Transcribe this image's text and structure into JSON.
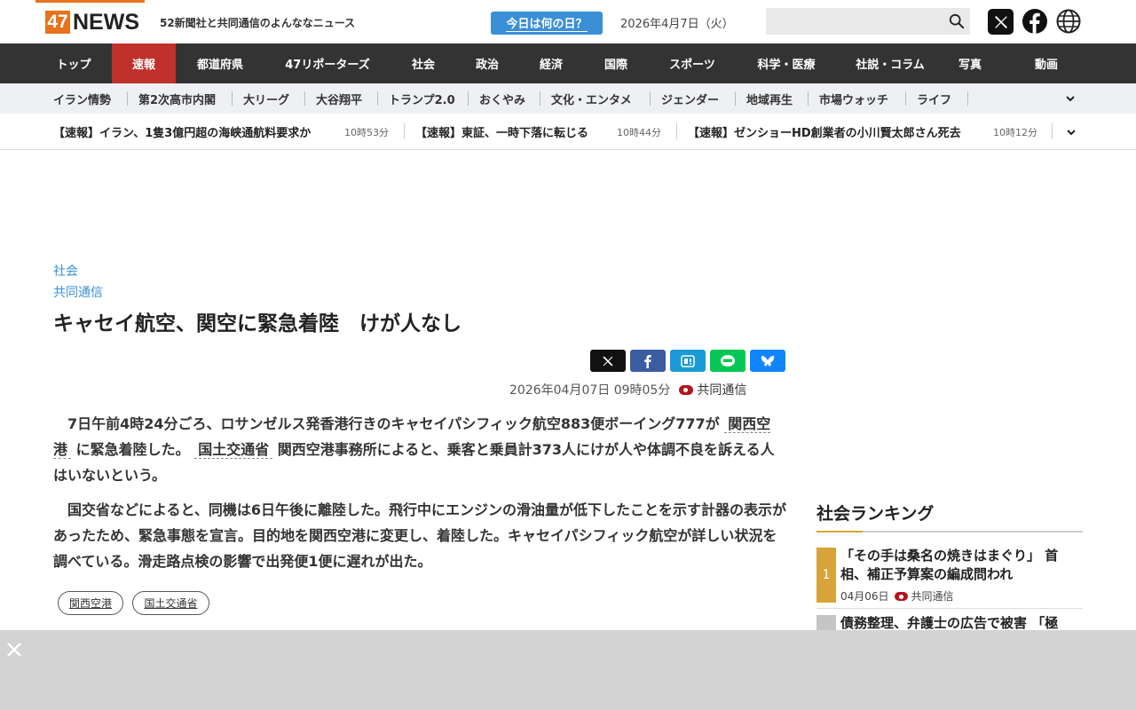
{
  "header": {
    "logo_num": "47",
    "logo_text": "NEWS",
    "tagline": "52新聞社と共同通信のよんななニュース",
    "today_button": "今日は何の日？",
    "date": "2026年4月7日（火）",
    "search_placeholder": ""
  },
  "main_nav": [
    "トップ",
    "速報",
    "都道府県",
    "47リポーターズ",
    "社会",
    "政治",
    "経済",
    "国際",
    "スポーツ",
    "科学・医療",
    "社説・コラム",
    "写真",
    "動画"
  ],
  "sub_nav": [
    "イラン情勢",
    "第2次高市内閣",
    "大リーグ",
    "大谷翔平",
    "トランプ2.0",
    "おくやみ",
    "文化・エンタメ",
    "ジェンダー",
    "地域再生",
    "市場ウォッチ",
    "ライフ"
  ],
  "ticker": [
    {
      "text": "【速報】イラン、1隻3億円超の海峡通航料要求か",
      "time": "10時53分"
    },
    {
      "text": "【速報】東証、一時下落に転じる",
      "time": "10時44分"
    },
    {
      "text": "【速報】ゼンショーHD創業者の小川賢太郎さん死去",
      "time": "10時12分"
    }
  ],
  "article": {
    "category": "社会",
    "source_label": "共同通信",
    "title": "キャセイ航空、関空に緊急着陸　けが人なし",
    "date": "2026年04月07日 09時05分",
    "source": "共同通信",
    "p1_a": "　7日午前4時24分ごろ、ロサンゼルス発香港行きのキャセイパシフィック航空883便ボーイング777が",
    "p1_link1": "関西空港",
    "p1_b": "に緊急着陸した。",
    "p1_link2": "国土交通省",
    "p1_c": "関西空港事務所によると、乗客と乗員計373人にけが人や体調不良を訴える人はいないという。",
    "p2": "　国交省などによると、同機は6日午後に離陸した。飛行中にエンジンの滑油量が低下したことを示す計器の表示があったため、緊急事態を宣言。目的地を関西空港に変更し、着陸した。キャセイパシフィック航空が詳しい状況を調べている。滑走路点検の影響で出発便1便に遅れが出た。",
    "tags": [
      "関西空港",
      "国土交通省"
    ]
  },
  "ranking": {
    "title": "社会ランキング",
    "items": [
      {
        "rank": "1",
        "text": "「その手は桑名の焼きはまぐり」 首相、補正予算案の編成問われ",
        "date": "04月06日",
        "source": "共同通信"
      },
      {
        "rank": "",
        "text": "債務整理、弁護士の広告で被害 「極",
        "date": "",
        "source": ""
      }
    ]
  },
  "colors": {
    "brand_orange": "#e8731c",
    "nav_dark": "#333333",
    "nav_active": "#c0312c",
    "link_blue": "#3a8fd6",
    "rank_gold": "#d7a43a"
  }
}
